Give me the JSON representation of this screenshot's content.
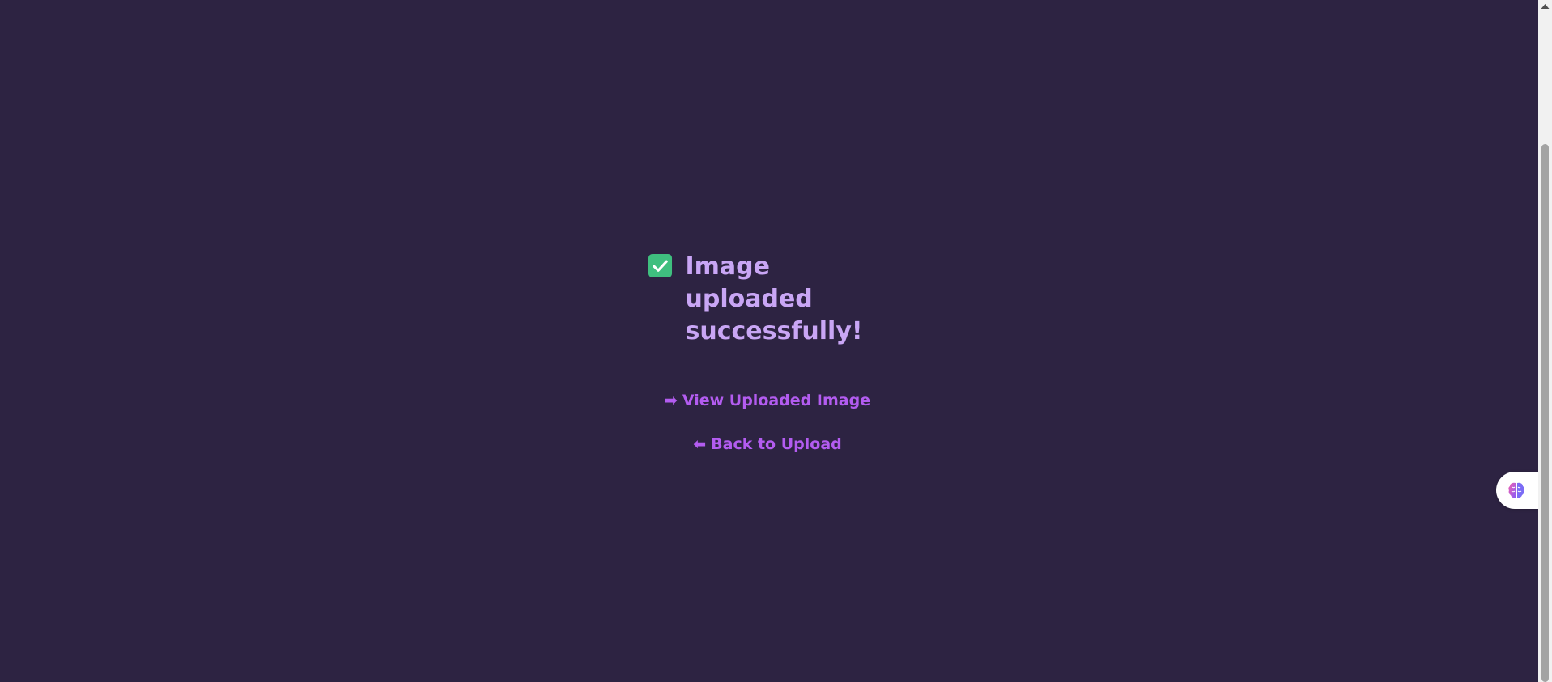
{
  "status": {
    "icon": "check-mark-button-icon",
    "message": "Image uploaded successfully!"
  },
  "links": {
    "view": {
      "arrow": "➡",
      "label": "View Uploaded Image"
    },
    "back": {
      "arrow": "⬅",
      "label": "Back to Upload"
    }
  },
  "widget": {
    "icon": "brain-icon"
  },
  "colors": {
    "background": "#2d2342",
    "heading": "#c9a6f5",
    "link": "#b35cf0",
    "check": "#3fbf7f"
  }
}
